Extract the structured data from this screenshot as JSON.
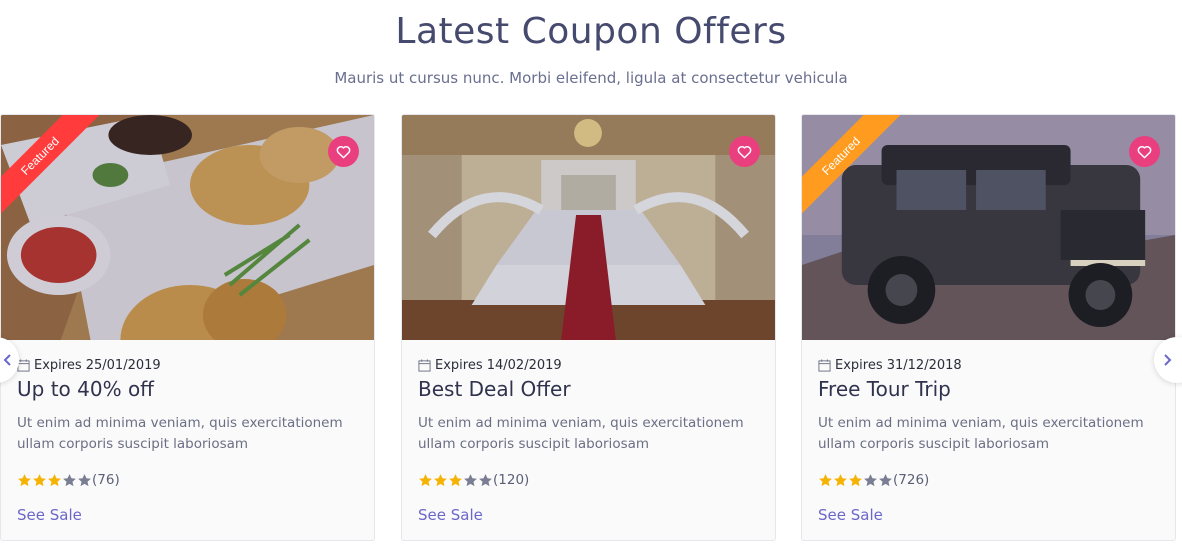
{
  "header": {
    "title": "Latest Coupon Offers",
    "subtitle": "Mauris ut cursus nunc. Morbi eleifend, ligula at consectetur vehicula"
  },
  "cards": [
    {
      "ribbon": "Featured",
      "ribbon_color": "#ff3b3b",
      "expires": "Expires 25/01/2019",
      "title": "Up to 40% off",
      "description": "Ut enim ad minima veniam, quis exercitationem ullam corporis suscipit laboriosam",
      "rating_stars": 3,
      "rating_count": "(76)",
      "cta": "See Sale"
    },
    {
      "ribbon": "",
      "expires": "Expires 14/02/2019",
      "title": "Best Deal Offer",
      "description": "Ut enim ad minima veniam, quis exercitationem ullam corporis suscipit laboriosam",
      "rating_stars": 3,
      "rating_count": "(120)",
      "cta": "See Sale"
    },
    {
      "ribbon": "Featured",
      "ribbon_color": "#ff9b1f",
      "expires": "Expires 31/12/2018",
      "title": "Free Tour Trip",
      "description": "Ut enim ad minima veniam, quis exercitationem ullam corporis suscipit laboriosam",
      "rating_stars": 3,
      "rating_count": "(726)",
      "cta": "See Sale"
    }
  ],
  "colors": {
    "heart_bg": "#ea3f7e",
    "star_filled": "#f5b301",
    "star_empty": "#7a7e93",
    "link": "#6a67c9"
  },
  "icons": {
    "favorite": "heart-icon",
    "calendar": "calendar-icon",
    "next": "chevron-right-icon",
    "prev": "chevron-left-icon"
  }
}
